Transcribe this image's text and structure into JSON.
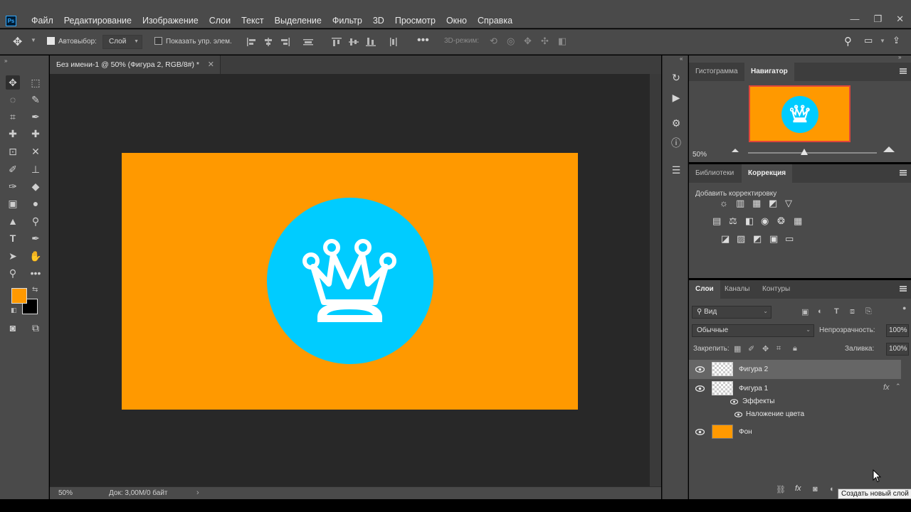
{
  "app": {
    "logo": "Ps"
  },
  "menu": [
    "Файл",
    "Редактирование",
    "Изображение",
    "Слои",
    "Текст",
    "Выделение",
    "Фильтр",
    "3D",
    "Просмотр",
    "Окно",
    "Справка"
  ],
  "window_controls": [
    "minimize-icon",
    "restore-icon",
    "close-icon"
  ],
  "options": {
    "autoselect_label": "Автовыбор:",
    "autoselect_checked": true,
    "target_select": "Слой",
    "show_transform_label": "Показать упр. элем.",
    "show_transform_checked": false,
    "mode_3d_label": "3D-режим:"
  },
  "document": {
    "tab_title": "Без имени-1 @ 50% (Фигура 2, RGB/8#) *",
    "canvas_color": "#ff9900",
    "circle_color": "#00ccff",
    "status_zoom": "50%",
    "status_doc": "Док: 3,00M/0 байт",
    "status_arrow": "›"
  },
  "colors": {
    "foreground": "#ff9900",
    "background": "#000000"
  },
  "navigator_panel": {
    "tabs": [
      "Гистограмма",
      "Навигатор"
    ],
    "active_tab": "Навигатор",
    "zoom": "50%"
  },
  "adjustments_panel": {
    "tabs": [
      "Библиотеки",
      "Коррекция"
    ],
    "active_tab": "Коррекция",
    "title": "Добавить корректировку"
  },
  "layers_panel": {
    "tabs": [
      "Слои",
      "Каналы",
      "Контуры"
    ],
    "active_tab": "Слои",
    "filter_kind": "Вид",
    "blend_mode": "Обычные",
    "opacity_label": "Непрозрачность:",
    "opacity_value": "100%",
    "lock_label": "Закрепить:",
    "fill_label": "Заливка:",
    "fill_value": "100%",
    "layers": [
      {
        "name": "Фигура 2",
        "selected": true,
        "fx": ""
      },
      {
        "name": "Фигура 1",
        "selected": false,
        "fx": "fx"
      },
      {
        "name": "Фон",
        "selected": false,
        "fx": ""
      }
    ],
    "effects_label": "Эффекты",
    "color_overlay_label": "Наложение цвета",
    "tooltip": "Создать новый слой"
  }
}
